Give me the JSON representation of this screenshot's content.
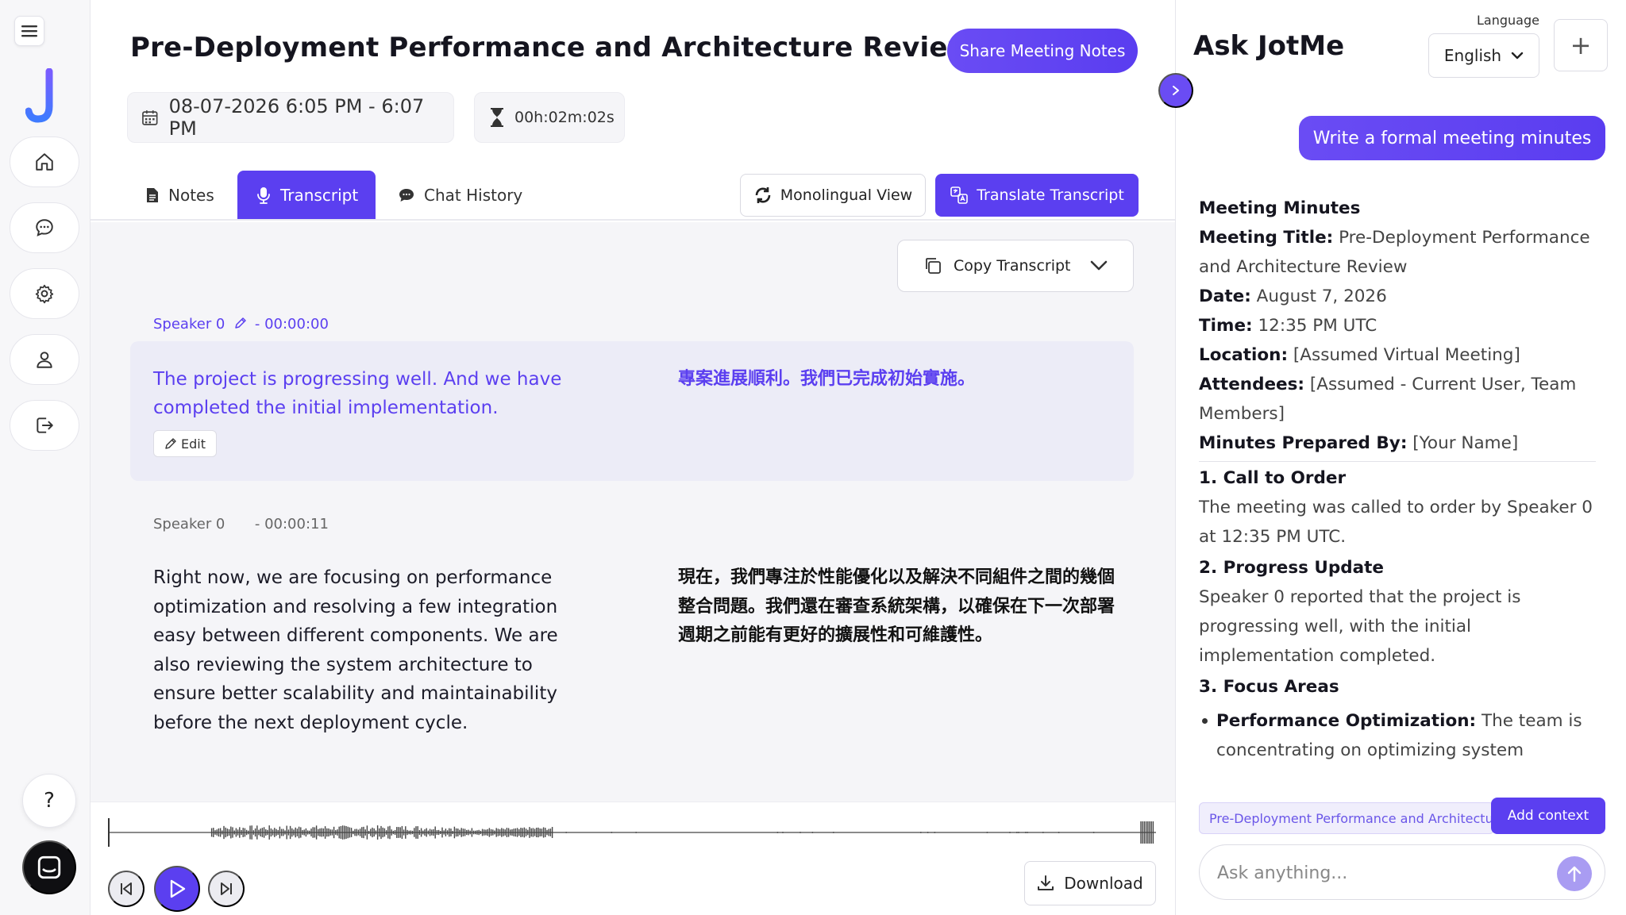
{
  "app": {
    "name": "JotMe"
  },
  "meeting": {
    "title": "Pre-Deployment Performance and Architecture Review",
    "share_label": "Share Meeting Notes",
    "date_range": "08-07-2026 6:05 PM - 6:07 PM",
    "duration": "00h:02m:02s"
  },
  "tabs": [
    {
      "label": "Notes"
    },
    {
      "label": "Transcript",
      "active": true
    },
    {
      "label": "Chat History"
    }
  ],
  "toolbar": {
    "monolingual_label": "Monolingual View",
    "translate_label": "Translate Transcript",
    "copy_label": "Copy Transcript"
  },
  "transcript": [
    {
      "speaker": "Speaker 0",
      "time": "- 00:00:00",
      "text": "The project is progressing well. And we have completed the initial implementation.",
      "translation": "專案進展順利。我們已完成初始實施。",
      "edit_label": "Edit"
    },
    {
      "speaker": "Speaker 0",
      "time": "- 00:00:11",
      "text": "Right now, we are focusing on performance optimization and resolving a few integration easy between different components. We are also reviewing the system architecture to ensure better scalability and maintainability before the next deployment cycle.",
      "translation": "現在，我們專注於性能優化以及解決不同組件之間的幾個整合問題。我們還在審查系統架構，以確保在下一次部署週期之前能有更好的擴展性和可維護性。"
    }
  ],
  "player": {
    "download_label": "Download",
    "progress": 0
  },
  "side": {
    "title": "Ask JotMe",
    "language_label": "Language",
    "language_value": "English",
    "new_chat_symbol": "+",
    "user_message": "Write a formal meeting minutes",
    "minutes": {
      "heading": "Meeting Minutes",
      "fields": [
        {
          "label": "Meeting Title:",
          "value": "Pre-Deployment Performance and Architecture Review"
        },
        {
          "label": "Date:",
          "value": "August 7, 2026"
        },
        {
          "label": "Time:",
          "value": "12:35 PM UTC"
        },
        {
          "label": "Location:",
          "value": "[Assumed Virtual Meeting]"
        },
        {
          "label": "Attendees:",
          "value": "[Assumed - Current User, Team Members]"
        },
        {
          "label": "Minutes Prepared By:",
          "value": "[Your Name]"
        }
      ],
      "sections": [
        {
          "heading": "1. Call to Order",
          "body": "The meeting was called to order by Speaker 0 at 12:35 PM UTC."
        },
        {
          "heading": "2. Progress Update",
          "body": "Speaker 0 reported that the project is progressing well, with the initial implementation completed."
        },
        {
          "heading": "3. Focus Areas",
          "bullet_label": "Performance Optimization:",
          "bullet_text": "The team is concentrating on optimizing system"
        }
      ]
    },
    "context_chip": "Pre-Deployment Performance and Architecture Review",
    "add_context_label": "Add context",
    "ask_placeholder": "Ask anything..."
  },
  "help_symbol": "?",
  "colors": {
    "accent": "#5b3ff0",
    "accent_light": "#ececf7",
    "surface": "#f5f5f8"
  }
}
